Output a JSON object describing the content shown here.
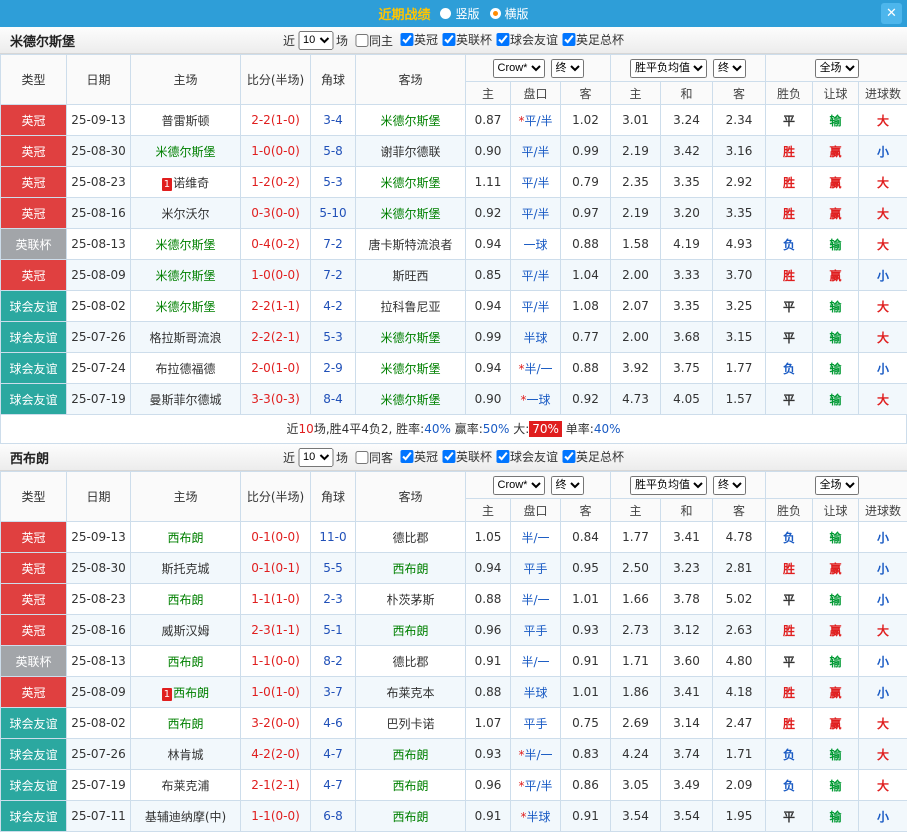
{
  "topbar": {
    "title": "近期战绩",
    "vertical_label": "竖版",
    "horizontal_label": "横版",
    "close": "✕"
  },
  "colors": {
    "topbar_bg": "#2e9ed8",
    "title": "#ffc400",
    "radio_selected": "#ff8a00",
    "league_yingguan": "#e04040",
    "league_yinglianbei": "#a2a5a9",
    "league_qiuhuiyouyi": "#2ba8a0",
    "focal_team": "#008000",
    "score": "#e01e1e",
    "handicap": "#1a5bc4",
    "win": "#e01e1e",
    "lose": "#009933",
    "small": "#1a5bc4"
  },
  "thead": {
    "type": "类型",
    "date": "日期",
    "home": "主场",
    "score": "比分(半场)",
    "corner": "角球",
    "away": "客场",
    "crow_select": "Crow*",
    "end_select": "终",
    "avg_select": "胜平负均值",
    "full_select": "全场",
    "odds_cols": [
      "主",
      "盘口",
      "客"
    ],
    "avg_cols": [
      "主",
      "和",
      "客"
    ],
    "result_cols": [
      "胜负",
      "让球",
      "进球数"
    ]
  },
  "sections": [
    {
      "team": "米德尔斯堡",
      "filter": {
        "near": "近",
        "count": "10",
        "games": "场",
        "same": "同主",
        "leagues": [
          "英冠",
          "英联杯",
          "球会友谊",
          "英足总杯"
        ]
      },
      "rows": [
        {
          "type": "英冠",
          "date": "25-09-13",
          "home": {
            "name": "普雷斯顿",
            "focal": false
          },
          "score": "2-2(1-0)",
          "corner": "3-4",
          "away": {
            "name": "米德尔斯堡",
            "focal": true
          },
          "crow": [
            "0.87",
            "*平/半",
            "1.02"
          ],
          "avg": [
            "3.01",
            "3.24",
            "2.34"
          ],
          "res": [
            "平",
            "输",
            "大"
          ]
        },
        {
          "type": "英冠",
          "date": "25-08-30",
          "home": {
            "name": "米德尔斯堡",
            "focal": true
          },
          "score": "1-0(0-0)",
          "corner": "5-8",
          "away": {
            "name": "谢菲尔德联",
            "focal": false
          },
          "crow": [
            "0.90",
            "平/半",
            "0.99"
          ],
          "avg": [
            "2.19",
            "3.42",
            "3.16"
          ],
          "res": [
            "胜",
            "赢",
            "小"
          ]
        },
        {
          "type": "英冠",
          "date": "25-08-23",
          "home": {
            "name": "诺维奇",
            "focal": false,
            "badge": "1"
          },
          "score": "1-2(0-2)",
          "corner": "5-3",
          "away": {
            "name": "米德尔斯堡",
            "focal": true
          },
          "crow": [
            "1.11",
            "平/半",
            "0.79"
          ],
          "avg": [
            "2.35",
            "3.35",
            "2.92"
          ],
          "res": [
            "胜",
            "赢",
            "大"
          ]
        },
        {
          "type": "英冠",
          "date": "25-08-16",
          "home": {
            "name": "米尔沃尔",
            "focal": false
          },
          "score": "0-3(0-0)",
          "corner": "5-10",
          "away": {
            "name": "米德尔斯堡",
            "focal": true
          },
          "crow": [
            "0.92",
            "平/半",
            "0.97"
          ],
          "avg": [
            "2.19",
            "3.20",
            "3.35"
          ],
          "res": [
            "胜",
            "赢",
            "大"
          ]
        },
        {
          "type": "英联杯",
          "date": "25-08-13",
          "home": {
            "name": "米德尔斯堡",
            "focal": true
          },
          "score": "0-4(0-2)",
          "corner": "7-2",
          "away": {
            "name": "唐卡斯特流浪者",
            "focal": false
          },
          "crow": [
            "0.94",
            "一球",
            "0.88"
          ],
          "avg": [
            "1.58",
            "4.19",
            "4.93"
          ],
          "res": [
            "负",
            "输",
            "大"
          ]
        },
        {
          "type": "英冠",
          "date": "25-08-09",
          "home": {
            "name": "米德尔斯堡",
            "focal": true
          },
          "score": "1-0(0-0)",
          "corner": "7-2",
          "away": {
            "name": "斯旺西",
            "focal": false
          },
          "crow": [
            "0.85",
            "平/半",
            "1.04"
          ],
          "avg": [
            "2.00",
            "3.33",
            "3.70"
          ],
          "res": [
            "胜",
            "赢",
            "小"
          ]
        },
        {
          "type": "球会友谊",
          "date": "25-08-02",
          "home": {
            "name": "米德尔斯堡",
            "focal": true
          },
          "score": "2-2(1-1)",
          "corner": "4-2",
          "away": {
            "name": "拉科鲁尼亚",
            "focal": false
          },
          "crow": [
            "0.94",
            "平/半",
            "1.08"
          ],
          "avg": [
            "2.07",
            "3.35",
            "3.25"
          ],
          "res": [
            "平",
            "输",
            "大"
          ]
        },
        {
          "type": "球会友谊",
          "date": "25-07-26",
          "home": {
            "name": "格拉斯哥流浪",
            "focal": false
          },
          "score": "2-2(2-1)",
          "corner": "5-3",
          "away": {
            "name": "米德尔斯堡",
            "focal": true
          },
          "crow": [
            "0.99",
            "半球",
            "0.77"
          ],
          "avg": [
            "2.00",
            "3.68",
            "3.15"
          ],
          "res": [
            "平",
            "输",
            "大"
          ]
        },
        {
          "type": "球会友谊",
          "date": "25-07-24",
          "home": {
            "name": "布拉德福德",
            "focal": false
          },
          "score": "2-0(1-0)",
          "corner": "2-9",
          "away": {
            "name": "米德尔斯堡",
            "focal": true
          },
          "crow": [
            "0.94",
            "*半/一",
            "0.88"
          ],
          "avg": [
            "3.92",
            "3.75",
            "1.77"
          ],
          "res": [
            "负",
            "输",
            "小"
          ]
        },
        {
          "type": "球会友谊",
          "date": "25-07-19",
          "home": {
            "name": "曼斯菲尔德城",
            "focal": false
          },
          "score": "3-3(0-3)",
          "corner": "8-4",
          "away": {
            "name": "米德尔斯堡",
            "focal": true
          },
          "crow": [
            "0.90",
            "*一球",
            "0.92"
          ],
          "avg": [
            "4.73",
            "4.05",
            "1.57"
          ],
          "res": [
            "平",
            "输",
            "大"
          ]
        }
      ],
      "summary": [
        {
          "t": "近"
        },
        {
          "t": "10",
          "c": "red"
        },
        {
          "t": "场,胜4平4负2, 胜率:"
        },
        {
          "t": "40%",
          "c": "blue"
        },
        {
          "t": " 赢率:"
        },
        {
          "t": "50%",
          "c": "blue"
        },
        {
          "t": " 大:"
        },
        {
          "t": "70%",
          "c": "badge"
        },
        {
          "t": " 单率:"
        },
        {
          "t": "40%",
          "c": "blue"
        }
      ]
    },
    {
      "team": "西布朗",
      "filter": {
        "near": "近",
        "count": "10",
        "games": "场",
        "same": "同客",
        "leagues": [
          "英冠",
          "英联杯",
          "球会友谊",
          "英足总杯"
        ]
      },
      "rows": [
        {
          "type": "英冠",
          "date": "25-09-13",
          "home": {
            "name": "西布朗",
            "focal": true
          },
          "score": "0-1(0-0)",
          "corner": "11-0",
          "away": {
            "name": "德比郡",
            "focal": false
          },
          "crow": [
            "1.05",
            "半/一",
            "0.84"
          ],
          "avg": [
            "1.77",
            "3.41",
            "4.78"
          ],
          "res": [
            "负",
            "输",
            "小"
          ]
        },
        {
          "type": "英冠",
          "date": "25-08-30",
          "home": {
            "name": "斯托克城",
            "focal": false
          },
          "score": "0-1(0-1)",
          "corner": "5-5",
          "away": {
            "name": "西布朗",
            "focal": true
          },
          "crow": [
            "0.94",
            "平手",
            "0.95"
          ],
          "avg": [
            "2.50",
            "3.23",
            "2.81"
          ],
          "res": [
            "胜",
            "赢",
            "小"
          ]
        },
        {
          "type": "英冠",
          "date": "25-08-23",
          "home": {
            "name": "西布朗",
            "focal": true
          },
          "score": "1-1(1-0)",
          "corner": "2-3",
          "away": {
            "name": "朴茨茅斯",
            "focal": false
          },
          "crow": [
            "0.88",
            "半/一",
            "1.01"
          ],
          "avg": [
            "1.66",
            "3.78",
            "5.02"
          ],
          "res": [
            "平",
            "输",
            "小"
          ]
        },
        {
          "type": "英冠",
          "date": "25-08-16",
          "home": {
            "name": "威斯汉姆",
            "focal": false
          },
          "score": "2-3(1-1)",
          "corner": "5-1",
          "away": {
            "name": "西布朗",
            "focal": true
          },
          "crow": [
            "0.96",
            "平手",
            "0.93"
          ],
          "avg": [
            "2.73",
            "3.12",
            "2.63"
          ],
          "res": [
            "胜",
            "赢",
            "大"
          ]
        },
        {
          "type": "英联杯",
          "date": "25-08-13",
          "home": {
            "name": "西布朗",
            "focal": true
          },
          "score": "1-1(0-0)",
          "corner": "8-2",
          "away": {
            "name": "德比郡",
            "focal": false
          },
          "crow": [
            "0.91",
            "半/一",
            "0.91"
          ],
          "avg": [
            "1.71",
            "3.60",
            "4.80"
          ],
          "res": [
            "平",
            "输",
            "小"
          ]
        },
        {
          "type": "英冠",
          "date": "25-08-09",
          "home": {
            "name": "西布朗",
            "focal": true,
            "badge": "1"
          },
          "score": "1-0(1-0)",
          "corner": "3-7",
          "away": {
            "name": "布莱克本",
            "focal": false
          },
          "crow": [
            "0.88",
            "半球",
            "1.01"
          ],
          "avg": [
            "1.86",
            "3.41",
            "4.18"
          ],
          "res": [
            "胜",
            "赢",
            "小"
          ]
        },
        {
          "type": "球会友谊",
          "date": "25-08-02",
          "home": {
            "name": "西布朗",
            "focal": true
          },
          "score": "3-2(0-0)",
          "corner": "4-6",
          "away": {
            "name": "巴列卡诺",
            "focal": false
          },
          "crow": [
            "1.07",
            "平手",
            "0.75"
          ],
          "avg": [
            "2.69",
            "3.14",
            "2.47"
          ],
          "res": [
            "胜",
            "赢",
            "大"
          ]
        },
        {
          "type": "球会友谊",
          "date": "25-07-26",
          "home": {
            "name": "林肯城",
            "focal": false
          },
          "score": "4-2(2-0)",
          "corner": "4-7",
          "away": {
            "name": "西布朗",
            "focal": true
          },
          "crow": [
            "0.93",
            "*半/一",
            "0.83"
          ],
          "avg": [
            "4.24",
            "3.74",
            "1.71"
          ],
          "res": [
            "负",
            "输",
            "大"
          ]
        },
        {
          "type": "球会友谊",
          "date": "25-07-19",
          "home": {
            "name": "布莱克浦",
            "focal": false
          },
          "score": "2-1(2-1)",
          "corner": "4-7",
          "away": {
            "name": "西布朗",
            "focal": true
          },
          "crow": [
            "0.96",
            "*平/半",
            "0.86"
          ],
          "avg": [
            "3.05",
            "3.49",
            "2.09"
          ],
          "res": [
            "负",
            "输",
            "大"
          ]
        },
        {
          "type": "球会友谊",
          "date": "25-07-11",
          "home": {
            "name": "基辅迪纳摩(中)",
            "focal": false
          },
          "score": "1-1(0-0)",
          "corner": "6-8",
          "away": {
            "name": "西布朗",
            "focal": true
          },
          "crow": [
            "0.91",
            "*半球",
            "0.91"
          ],
          "avg": [
            "3.54",
            "3.54",
            "1.95"
          ],
          "res": [
            "平",
            "输",
            "小"
          ]
        }
      ]
    }
  ]
}
